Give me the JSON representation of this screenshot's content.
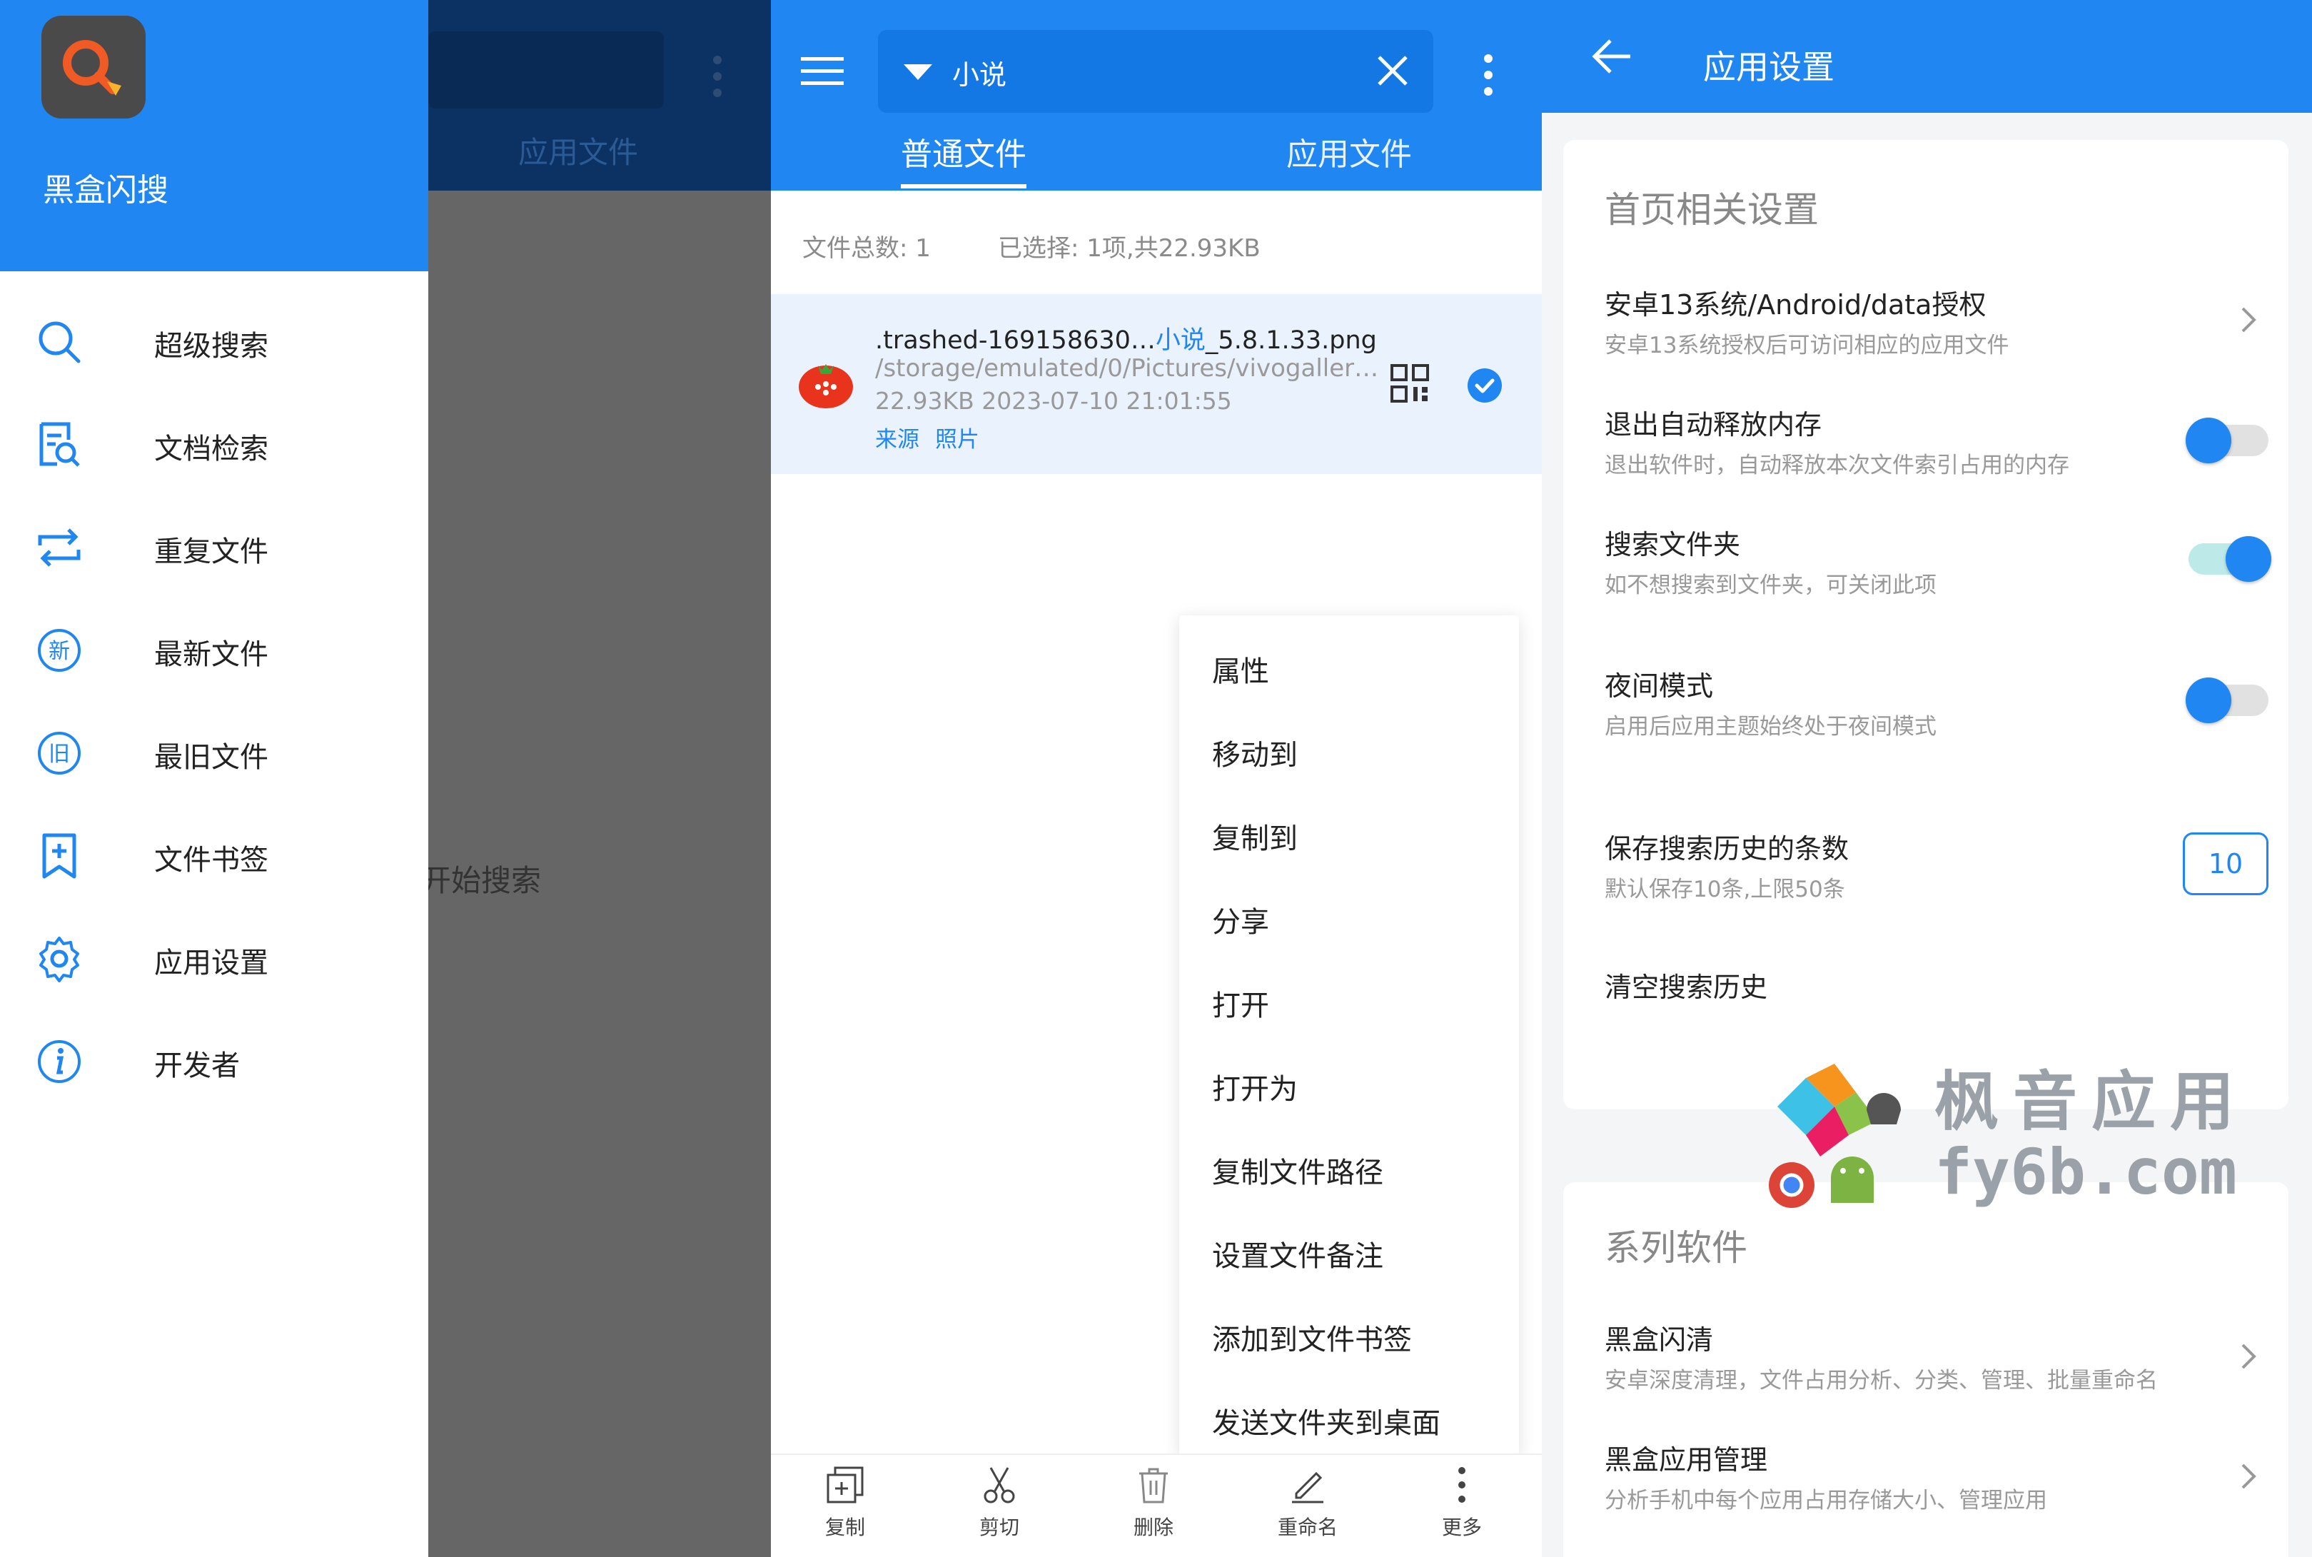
{
  "drawer": {
    "app_title": "黑盒闪搜",
    "items": [
      {
        "label": "超级搜索",
        "icon": "search-icon"
      },
      {
        "label": "文档检索",
        "icon": "document-search-icon"
      },
      {
        "label": "重复文件",
        "icon": "repeat-icon"
      },
      {
        "label": "最新文件",
        "icon": "new-badge-icon"
      },
      {
        "label": "最旧文件",
        "icon": "old-badge-icon"
      },
      {
        "label": "文件书签",
        "icon": "bookmark-add-icon"
      },
      {
        "label": "应用设置",
        "icon": "gear-icon"
      },
      {
        "label": "开发者",
        "icon": "info-icon"
      }
    ],
    "background": {
      "tab_label": "应用文件",
      "start_search": "开始搜索"
    }
  },
  "search": {
    "query": "小说",
    "tabs": [
      "普通文件",
      "应用文件"
    ],
    "total": "文件总数: 1",
    "selected": "已选择: 1项,共22.93KB",
    "file": {
      "name_prefix": ".trashed-169158630…",
      "name_highlight": "小说",
      "name_suffix": "_5.8.1.33.png",
      "path": "/storage/emulated/0/Pictures/vivogaller…",
      "meta": "22.93KB  2023-07-10 21:01:55",
      "tags": [
        "来源",
        "照片"
      ]
    },
    "context_menu": [
      "属性",
      "移动到",
      "复制到",
      "分享",
      "打开",
      "打开为",
      "复制文件路径",
      "设置文件备注",
      "添加到文件书签",
      "发送文件夹到桌面"
    ],
    "bottom_bar": [
      {
        "label": "复制",
        "icon": "copy-icon"
      },
      {
        "label": "剪切",
        "icon": "scissors-icon"
      },
      {
        "label": "删除",
        "icon": "trash-icon"
      },
      {
        "label": "重命名",
        "icon": "pencil-icon"
      },
      {
        "label": "更多",
        "icon": "more-vertical-icon"
      }
    ]
  },
  "settings": {
    "title": "应用设置",
    "section1": "首页相关设置",
    "rows": [
      {
        "title": "安卓13系统/Android/data授权",
        "sub": "安卓13系统授权后可访问相应的应用文件"
      },
      {
        "title": "退出自动释放内存",
        "sub": "退出软件时，自动释放本次文件索引占用的内存",
        "toggle": false
      },
      {
        "title": "搜索文件夹",
        "sub": "如不想搜索到文件夹，可关闭此项",
        "toggle": true
      },
      {
        "title": "夜间模式",
        "sub": "启用后应用主题始终处于夜间模式",
        "toggle": false
      },
      {
        "title": "保存搜索历史的条数",
        "sub": "默认保存10条,上限50条",
        "value": "10"
      },
      {
        "title": "清空搜索历史"
      }
    ],
    "section2": "系列软件",
    "series": [
      {
        "title": "黑盒闪清",
        "sub": "安卓深度清理，文件占用分析、分类、管理、批量重命名"
      },
      {
        "title": "黑盒应用管理",
        "sub": "分析手机中每个应用占用存储大小、管理应用"
      }
    ]
  },
  "watermark": {
    "line1": "枫音应用",
    "line2": "fy6b.com"
  },
  "colors": {
    "primary": "#1f86f2",
    "toggle_on_track": "#bde9e8",
    "drawer_scrim": "#666666"
  }
}
